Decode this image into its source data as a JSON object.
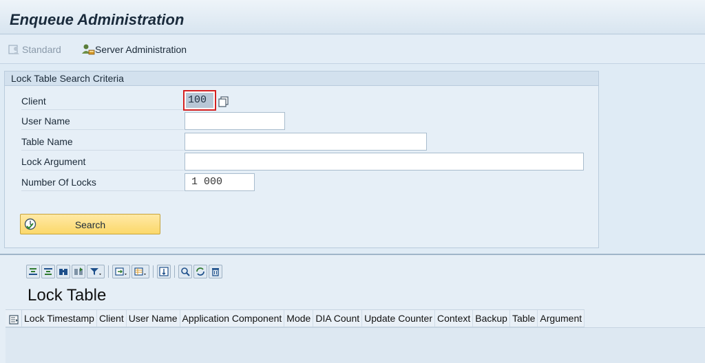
{
  "title": "Enqueue Administration",
  "toolbar": {
    "standard_label": "Standard",
    "server_admin_label": "Server Administration"
  },
  "criteria": {
    "group_title": "Lock Table Search Criteria",
    "client_label": "Client",
    "client_value": "100",
    "user_label": "User Name",
    "user_value": "",
    "table_label": "Table Name",
    "table_value": "",
    "argument_label": "Lock Argument",
    "argument_value": "",
    "number_label": "Number Of Locks",
    "number_value": "1 000",
    "search_label": "Search"
  },
  "lock_table": {
    "title": "Lock Table",
    "columns": [
      "Lock Timestamp",
      "Client",
      "User Name",
      "Application Component",
      "Mode",
      "DIA Count",
      "Update Counter",
      "Context",
      "Backup",
      "Table",
      "Argument"
    ]
  },
  "icons": {
    "standard": "user-settings-icon",
    "server_admin": "server-admin-icon",
    "copy": "multiple-selection-icon",
    "search": "execute-search-icon",
    "select_all": "select-layout-icon"
  },
  "colors": {
    "accent": "#fbd86a",
    "focus_border": "#d42020",
    "background": "#dfebf5"
  }
}
